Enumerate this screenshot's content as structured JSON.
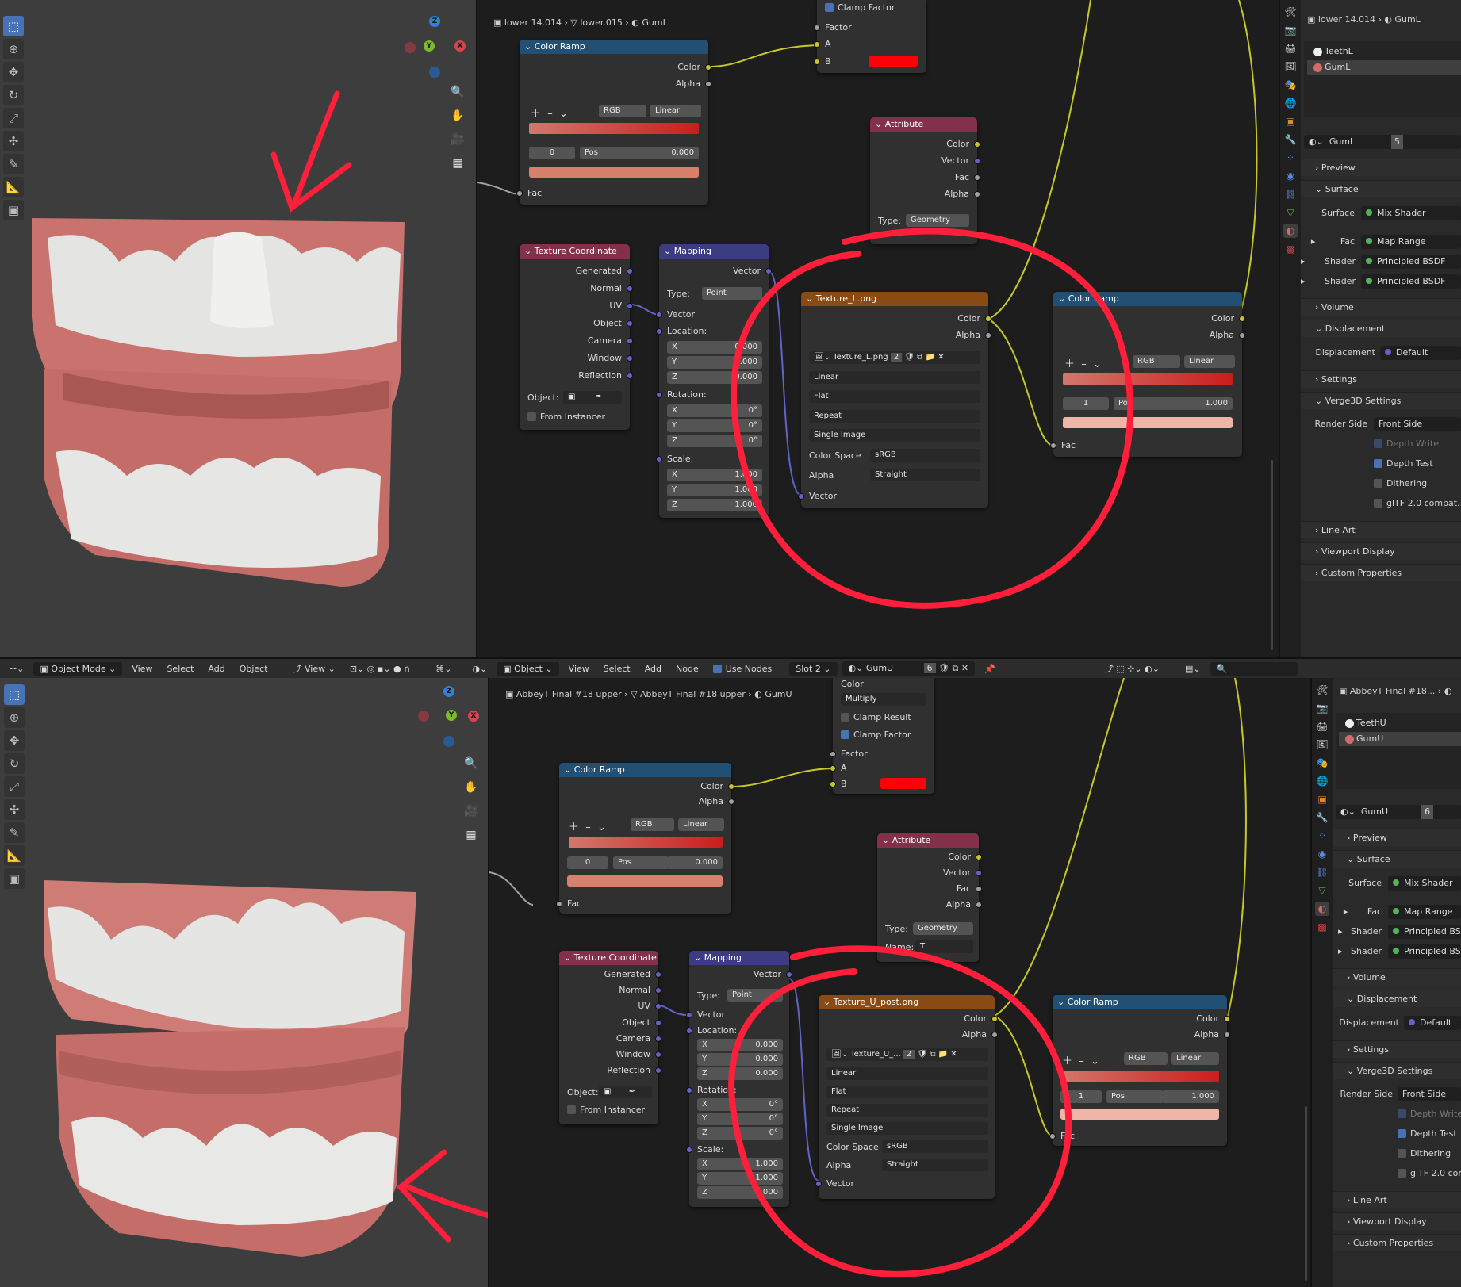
{
  "top": {
    "crumbs": [
      "lower 14.014",
      "lower.015",
      "GumL"
    ],
    "props_crumbs": [
      "lower 14.014",
      "GumL"
    ],
    "mix": {
      "label_cf": "Clamp Factor",
      "factor": "Factor",
      "a": "A",
      "b": "B"
    },
    "color_ramp_a": {
      "title": "Color Ramp",
      "out_color": "Color",
      "out_alpha": "Alpha",
      "mode": "RGB",
      "interp": "Linear",
      "index": "0",
      "pos_label": "Pos",
      "pos": "0.000",
      "fac": "Fac"
    },
    "attribute": {
      "title": "Attribute",
      "color": "Color",
      "vector": "Vector",
      "fac": "Fac",
      "alpha": "Alpha",
      "type_label": "Type:",
      "type": "Geometry"
    },
    "texcoord": {
      "title": "Texture Coordinate",
      "outputs": [
        "Generated",
        "Normal",
        "UV",
        "Object",
        "Camera",
        "Window",
        "Reflection"
      ],
      "object_label": "Object:",
      "from_instancer": "From Instancer"
    },
    "mapping": {
      "title": "Mapping",
      "vector_out": "Vector",
      "type_label": "Type:",
      "type": "Point",
      "vector_in": "Vector",
      "location": "Location:",
      "loc": [
        "0.000",
        "0.000",
        "0.000"
      ],
      "rotation": "Rotation:",
      "rot": [
        "0°",
        "0°",
        "0°"
      ],
      "scale": "Scale:",
      "scl": [
        "1.000",
        "1.000",
        "1.000"
      ],
      "axes": [
        "X",
        "Y",
        "Z"
      ]
    },
    "image": {
      "title": "Texture_L.png",
      "color": "Color",
      "alpha": "Alpha",
      "file": "Texture_L.png",
      "users": "2",
      "interp": "Linear",
      "proj": "Flat",
      "ext": "Repeat",
      "source": "Single Image",
      "cs_label": "Color Space",
      "cs": "sRGB",
      "alpha_label": "Alpha",
      "alpha_mode": "Straight",
      "vector": "Vector"
    },
    "color_ramp_b": {
      "title": "Color Ramp",
      "out_color": "Color",
      "out_alpha": "Alpha",
      "mode": "RGB",
      "interp": "Linear",
      "index": "1",
      "pos_label": "Pos",
      "pos": "1.000",
      "fac": "Fac"
    },
    "slots": [
      "TeethL",
      "GumL"
    ],
    "material": {
      "name": "GumL",
      "users": "5"
    }
  },
  "bottom": {
    "header": {
      "mode": "Object Mode",
      "menus": [
        "View",
        "Select",
        "Add",
        "Object"
      ],
      "view": "View",
      "ne_object": "Object",
      "ne_menus": [
        "View",
        "Select",
        "Add",
        "Node"
      ],
      "use_nodes": "Use Nodes",
      "slot": "Slot 2",
      "material": "GumU",
      "users": "6"
    },
    "crumbs": [
      "AbbeyT Final #18 upper",
      "AbbeyT Final #18 upper",
      "GumU"
    ],
    "props_crumbs": [
      "AbbeyT Final #18..."
    ],
    "mix": {
      "color": "Color",
      "blend": "Multiply",
      "clamp_result": "Clamp Result",
      "clamp_factor": "Clamp Factor",
      "factor": "Factor",
      "a": "A",
      "b": "B"
    },
    "color_ramp_a": {
      "title": "Color Ramp",
      "out_color": "Color",
      "out_alpha": "Alpha",
      "mode": "RGB",
      "interp": "Linear",
      "index": "0",
      "pos_label": "Pos",
      "pos": "0.000",
      "fac": "Fac"
    },
    "attribute": {
      "title": "Attribute",
      "color": "Color",
      "vector": "Vector",
      "fac": "Fac",
      "alpha": "Alpha",
      "type_label": "Type:",
      "type": "Geometry",
      "name_label": "Name:",
      "name": "T"
    },
    "texcoord": {
      "title": "Texture Coordinate",
      "outputs": [
        "Generated",
        "Normal",
        "UV",
        "Object",
        "Camera",
        "Window",
        "Reflection"
      ],
      "object_label": "Object:",
      "from_instancer": "From Instancer"
    },
    "mapping": {
      "title": "Mapping",
      "vector_out": "Vector",
      "type_label": "Type:",
      "type": "Point",
      "vector_in": "Vector",
      "location": "Location:",
      "loc": [
        "0.000",
        "0.000",
        "0.000"
      ],
      "rotation": "Rotation:",
      "rot": [
        "0°",
        "0°",
        "0°"
      ],
      "scale": "Scale:",
      "scl": [
        "1.000",
        "1.000",
        "1.000"
      ],
      "axes": [
        "X",
        "Y",
        "Z"
      ]
    },
    "image": {
      "title": "Texture_U_post.png",
      "color": "Color",
      "alpha": "Alpha",
      "file": "Texture_U_...",
      "users": "2",
      "interp": "Linear",
      "proj": "Flat",
      "ext": "Repeat",
      "source": "Single Image",
      "cs_label": "Color Space",
      "cs": "sRGB",
      "alpha_label": "Alpha",
      "alpha_mode": "Straight",
      "vector": "Vector"
    },
    "color_ramp_b": {
      "title": "Color Ramp",
      "out_color": "Color",
      "out_alpha": "Alpha",
      "mode": "RGB",
      "interp": "Linear",
      "index": "1",
      "pos_label": "Pos",
      "pos": "1.000",
      "fac": "Fac"
    },
    "slots": [
      "TeethU",
      "GumU"
    ],
    "material": {
      "name": "GumU",
      "users": "6"
    }
  },
  "props": {
    "preview": "Preview",
    "surface": "Surface",
    "surface_label": "Surface",
    "surface_val": "Mix Shader",
    "fac_label": "Fac",
    "fac_val": "Map Range",
    "shader_label": "Shader",
    "shader_val": "Principled BSDF",
    "volume": "Volume",
    "displacement": "Displacement",
    "disp_label": "Displacement",
    "disp_val": "Default",
    "settings": "Settings",
    "verge": "Verge3D Settings",
    "render_side_label": "Render Side",
    "render_side": "Front Side",
    "depth_write": "Depth Write",
    "depth_test": "Depth Test",
    "dithering": "Dithering",
    "gltf": "glTF 2.0 compat...",
    "line_art": "Line Art",
    "viewport_display": "Viewport Display",
    "custom_props": "Custom Properties"
  },
  "colors": {
    "annotation": "#ff1f3a",
    "gum": "#d4837d",
    "tooth": "#e9e9e7",
    "mix_b": "#ff0008"
  }
}
